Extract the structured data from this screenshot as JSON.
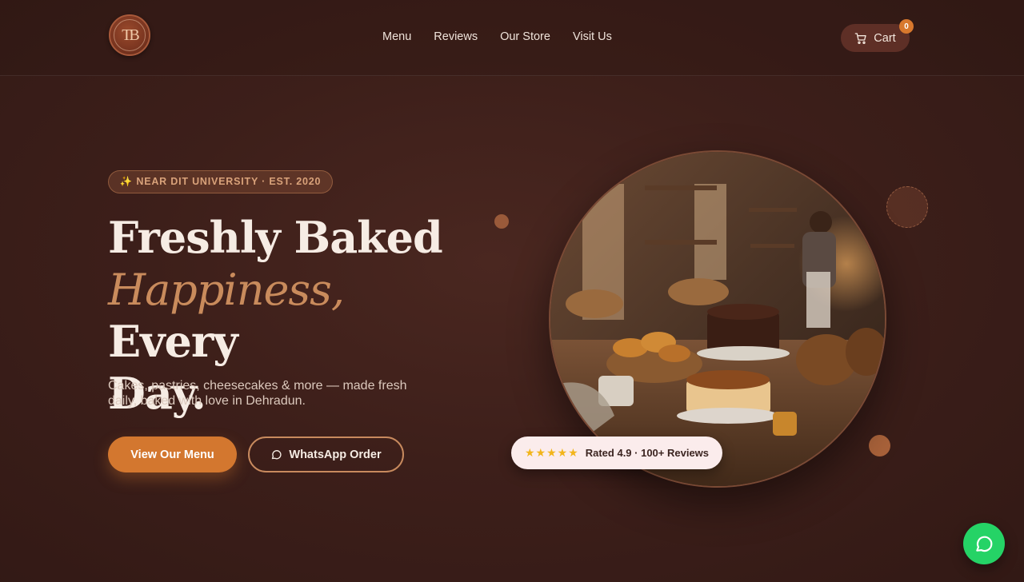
{
  "header": {
    "logo_text": "TB",
    "nav": [
      {
        "label": "Menu"
      },
      {
        "label": "Reviews"
      },
      {
        "label": "Our Store"
      },
      {
        "label": "Visit Us"
      }
    ],
    "cart": {
      "label": "Cart",
      "count": "0",
      "icon": "cart-icon"
    }
  },
  "hero": {
    "badge": "✨ NEAR DIT UNIVERSITY · EST. 2020",
    "headline_line1": "Freshly Baked",
    "headline_accent": "Happiness,",
    "headline_line2_rest": " Every",
    "headline_line3": "Day.",
    "subtext": "Cakes, pastries, cheesecakes & more — made fresh daily, baked with love in Dehradun.",
    "primary_button": "View Our Menu",
    "secondary_button": "WhatsApp Order",
    "secondary_icon": "chat-bubble-icon",
    "rating": {
      "stars": "★★★★★",
      "text": "Rated 4.9 · 100+ Reviews"
    }
  },
  "fab": {
    "icon": "whatsapp-icon"
  },
  "colors": {
    "background": "#3d1f1a",
    "accent": "#d3772f",
    "accent_text": "#c98b5c",
    "whatsapp": "#25d366"
  }
}
